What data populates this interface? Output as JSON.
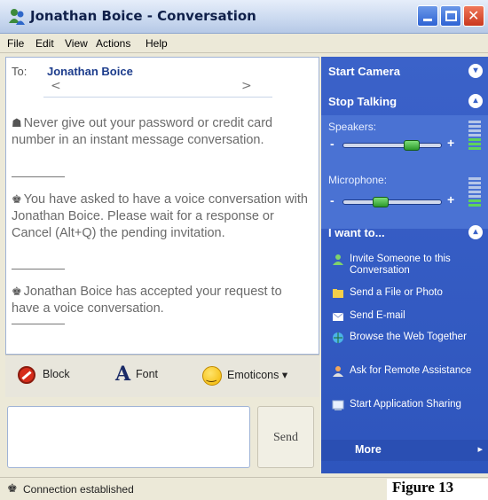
{
  "window": {
    "title": "Jonathan Boice - Conversation"
  },
  "menu": {
    "items": [
      "File",
      "Edit",
      "View",
      "Actions",
      "Help"
    ]
  },
  "conversation": {
    "to_label": "To:",
    "to_name": "Jonathan Boice",
    "nav_prev": "<",
    "nav_next": ">",
    "messages": [
      "Never give out your password or credit card number in an instant message conversation.",
      "You have asked to have a voice conversation with Jonathan Boice. Please wait for a response or Cancel (Alt+Q) the pending invitation.",
      "Jonathan Boice has accepted your request to have a voice conversation."
    ]
  },
  "toolbar": {
    "block": "Block",
    "font": "Font",
    "font_glyph": "A",
    "emoticons": "Emoticons ▾"
  },
  "compose": {
    "send": "Send"
  },
  "sidebar": {
    "start_camera": "Start Camera",
    "stop_talking": "Stop Talking",
    "speakers_label": "Speakers:",
    "microphone_label": "Microphone:",
    "speakers_level": 0.72,
    "microphone_level": 0.35,
    "i_want_to": "I want to...",
    "tasks": [
      "Invite Someone to this Conversation",
      "Send a File or Photo",
      "Send E-mail",
      "Browse the Web Together",
      "Ask for Remote Assistance",
      "Start Application Sharing"
    ],
    "more": "More"
  },
  "status": {
    "text": "Connection established"
  },
  "caption": {
    "figure": "Figure 13"
  },
  "colors": {
    "sidebar_blue": "#3b62c9",
    "titlebar": "#c9d8ef",
    "close_red": "#c9381e"
  }
}
